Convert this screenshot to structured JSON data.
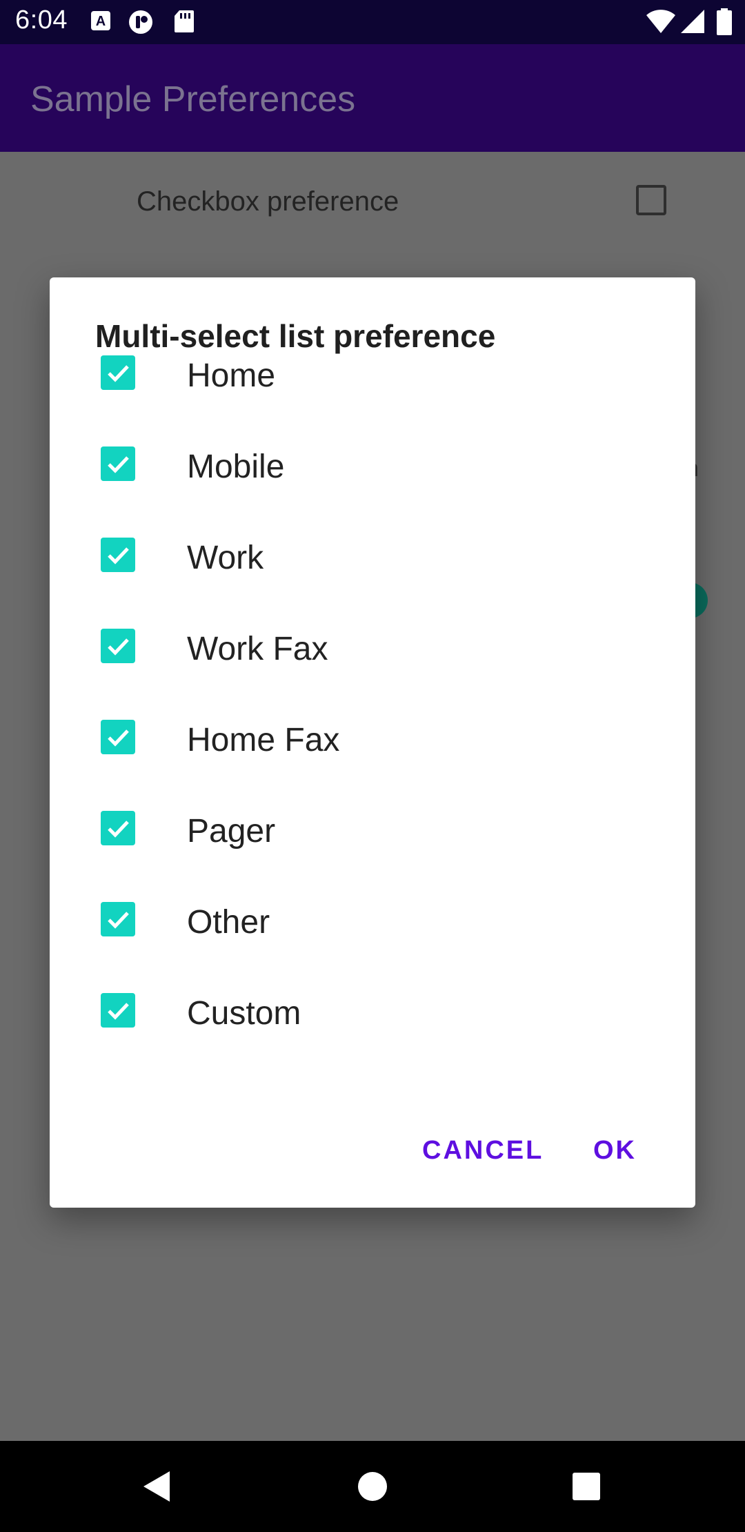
{
  "status_bar": {
    "time": "6:04",
    "notification_icons": [
      "a-icon",
      "tag-icon",
      "sd-card-icon"
    ],
    "system_icons": [
      "wifi-icon",
      "cell-signal-icon",
      "battery-icon"
    ]
  },
  "app_bar": {
    "title": "Sample Preferences"
  },
  "background": {
    "checkbox_pref_label": "Checkbox preference",
    "checkbox_pref_checked": false
  },
  "dialog": {
    "title": "Multi-select list preference",
    "options": [
      {
        "label": "Home",
        "checked": true
      },
      {
        "label": "Mobile",
        "checked": true
      },
      {
        "label": "Work",
        "checked": true
      },
      {
        "label": "Work Fax",
        "checked": true
      },
      {
        "label": "Home Fax",
        "checked": true
      },
      {
        "label": "Pager",
        "checked": true
      },
      {
        "label": "Other",
        "checked": true
      },
      {
        "label": "Custom",
        "checked": true
      }
    ],
    "cancel_label": "CANCEL",
    "ok_label": "OK"
  },
  "colors": {
    "accent": "#12d3c0",
    "button_text": "#5e0fe0",
    "app_bar": "#26045a",
    "scrim": "#6b6b6b"
  },
  "nav_bar": {
    "buttons": [
      "back-icon",
      "home-icon",
      "recents-icon"
    ]
  }
}
